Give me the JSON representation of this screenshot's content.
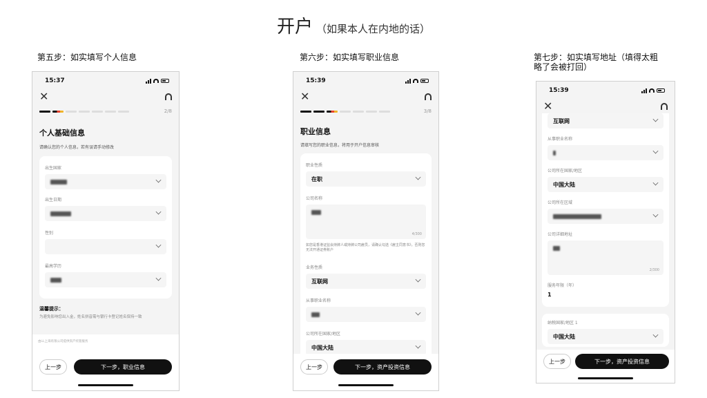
{
  "title": {
    "main": "开户",
    "sub": "（如果本人在内地的话）"
  },
  "steps": [
    {
      "caption": "第五步：如实填写个人信息",
      "time": "15:37",
      "progress_count": "2/8",
      "screen_title": "个人基础信息",
      "screen_subtitle": "请确认您的个人信息，若有误请手动修改",
      "fields": [
        {
          "label": "出生国家",
          "value": ""
        },
        {
          "label": "出生日期",
          "value": ""
        },
        {
          "label": "性别",
          "value": ""
        },
        {
          "label": "最高学历",
          "value": ""
        }
      ],
      "tip_title": "温馨提示：",
      "tip_text": "为避免影响您出入金，姓名拼音需与银行卡登记姓名保持一致",
      "legal": "由LL上海有限公司提供资产托管服务",
      "prev_label": "上一步",
      "next_label": "下一步，职业信息"
    },
    {
      "caption": "第六步：如实填写职业信息",
      "time": "15:39",
      "progress_count": "3/8",
      "screen_title": "职业信息",
      "screen_subtitle": "请填写您的职业信息，将用于开户信息审核",
      "fields": [
        {
          "label": "职业性质",
          "value": "在职"
        },
        {
          "label": "公司名称",
          "value": "",
          "counter": "4/300"
        },
        {
          "label": "业务性质",
          "value": "互联网"
        },
        {
          "label": "从事职业名称",
          "value": ""
        },
        {
          "label": "公司所在国家/地区",
          "value": "中国大陆"
        }
      ],
      "company_note": "如您是香港证监会持牌人或持牌公司雇员，请确认勾选《雇主同意书》，否则您无法开通证券账户",
      "prev_label": "上一步",
      "next_label": "下一步，资产投资信息"
    },
    {
      "caption": "第七步：如实填写地址（填得太粗略了会被打回）",
      "time": "15:39",
      "fields": [
        {
          "label": "",
          "value": "互联网"
        },
        {
          "label": "从事职业名称",
          "value": ""
        },
        {
          "label": "公司所在国家/地区",
          "value": "中国大陆"
        },
        {
          "label": "公司所在区域",
          "value": ""
        },
        {
          "label": "公司详细地址",
          "value": "",
          "counter": "2/300"
        }
      ],
      "service_years_label": "服务年限（年）",
      "service_years_value": "1",
      "tax_label": "纳税国家/地区 1",
      "tax_value": "中国大陆",
      "prev_label": "上一步",
      "next_label": "下一步，资产投资信息"
    }
  ]
}
